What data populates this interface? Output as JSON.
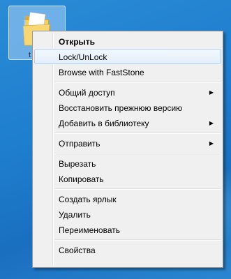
{
  "desktop": {
    "icon_label": "t"
  },
  "context_menu": {
    "open": "Открыть",
    "lock_unlock": "Lock/UnLock",
    "browse_faststone": "Browse with FastStone",
    "sharing": "Общий доступ",
    "restore_previous": "Восстановить прежнюю версию",
    "add_to_library": "Добавить в библиотеку",
    "send_to": "Отправить",
    "cut": "Вырезать",
    "copy": "Копировать",
    "create_shortcut": "Создать ярлык",
    "delete": "Удалить",
    "rename": "Переименовать",
    "properties": "Свойства",
    "submenu_arrow": "▶"
  }
}
